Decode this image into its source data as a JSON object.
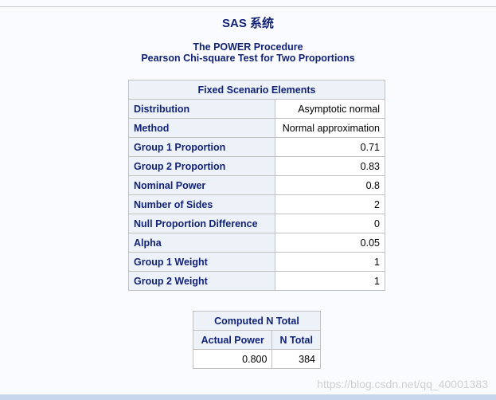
{
  "header": {
    "title": "SAS 系统",
    "procedure": "The POWER Procedure",
    "test": "Pearson Chi-square Test for Two Proportions"
  },
  "fixed_table": {
    "caption": "Fixed Scenario Elements",
    "rows": [
      {
        "label": "Distribution",
        "value": "Asymptotic normal"
      },
      {
        "label": "Method",
        "value": "Normal approximation"
      },
      {
        "label": "Group 1 Proportion",
        "value": "0.71"
      },
      {
        "label": "Group 2 Proportion",
        "value": "0.83"
      },
      {
        "label": "Nominal Power",
        "value": "0.8"
      },
      {
        "label": "Number of Sides",
        "value": "2"
      },
      {
        "label": "Null Proportion Difference",
        "value": "0"
      },
      {
        "label": "Alpha",
        "value": "0.05"
      },
      {
        "label": "Group 1 Weight",
        "value": "1"
      },
      {
        "label": "Group 2 Weight",
        "value": "1"
      }
    ]
  },
  "computed_table": {
    "caption": "Computed N Total",
    "headers": [
      "Actual Power",
      "N Total"
    ],
    "values": [
      "0.800",
      "384"
    ]
  },
  "watermark": "https://blog.csdn.net/qq_40001383",
  "colors": {
    "heading_text": "#112277",
    "header_cell_bg": "#edf2f9",
    "grid_border": "#c1c1c1",
    "page_bg": "#fafbfe"
  }
}
